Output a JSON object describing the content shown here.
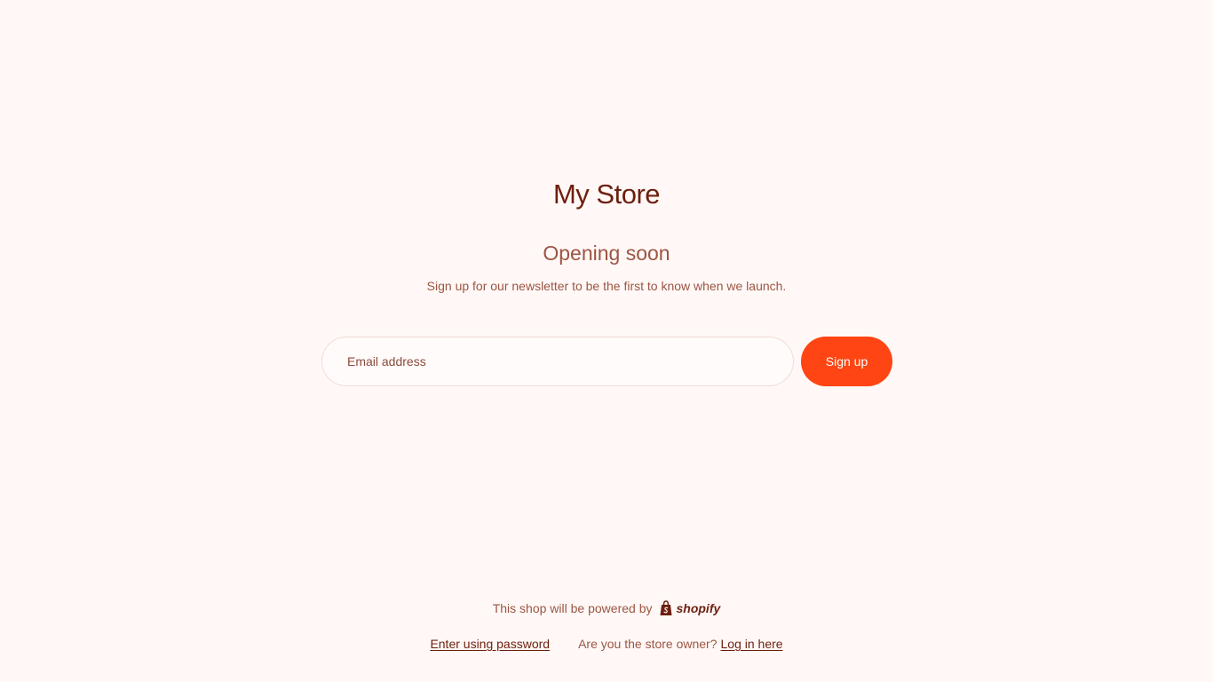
{
  "store": {
    "name": "My Store"
  },
  "main": {
    "headline": "Opening soon",
    "subtext": "Sign up for our newsletter to be the first to know when we launch."
  },
  "newsletter": {
    "email_placeholder": "Email address",
    "email_value": "",
    "signup_label": "Sign up"
  },
  "footer": {
    "powered_text": "This shop will be powered by",
    "shopify_logo_text": "shopify",
    "shopify_icon": "shopify-bag-icon",
    "enter_password_label": "Enter using password",
    "owner_question": "Are you the store owner?",
    "login_label": "Log in here"
  },
  "colors": {
    "background": "#fff8f6",
    "title": "#6e1e0f",
    "text": "#9c5543",
    "accent": "#ff4513",
    "input_border": "#f1dcd6"
  }
}
